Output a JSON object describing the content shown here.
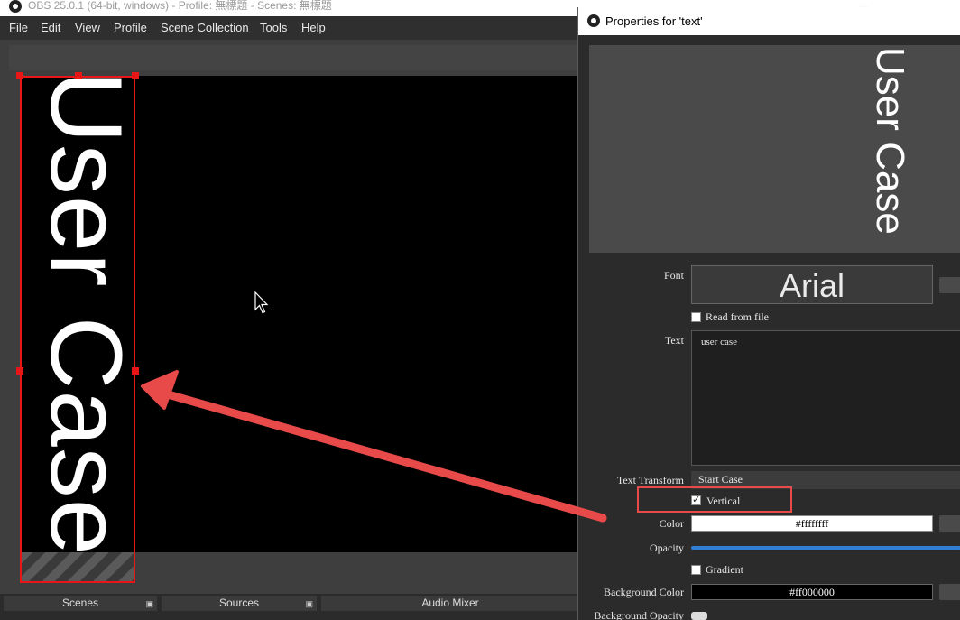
{
  "obs_window": {
    "title": "OBS 25.0.1 (64-bit, windows) - Profile: 無標題 - Scenes: 無標題",
    "menu": [
      "File",
      "Edit",
      "View",
      "Profile",
      "Scene Collection",
      "Tools",
      "Help"
    ],
    "canvas_text": "User Case",
    "docks": {
      "scenes": "Scenes",
      "sources": "Sources",
      "audio_mixer": "Audio Mixer"
    }
  },
  "properties": {
    "title": "Properties for 'text'",
    "preview_text": "User Case",
    "labels": {
      "font": "Font",
      "text": "Text",
      "text_transform": "Text Transform",
      "color": "Color",
      "opacity": "Opacity",
      "background_color": "Background Color",
      "background_opacity": "Background Opacity"
    },
    "font_value": "Arial",
    "read_from_file": {
      "label": "Read from file",
      "checked": false
    },
    "text_value": "user case",
    "text_transform_value": "Start Case",
    "vertical": {
      "label": "Vertical",
      "checked": true
    },
    "color_value": "#ffffffff",
    "opacity_level": 1.0,
    "gradient": {
      "label": "Gradient",
      "checked": false
    },
    "background_color_value": "#ff000000",
    "background_opacity_level": 0.0
  },
  "colors": {
    "selection_red": "#e81616",
    "annotation_red": "#e84a4a",
    "slider_blue": "#2f7fd6"
  }
}
